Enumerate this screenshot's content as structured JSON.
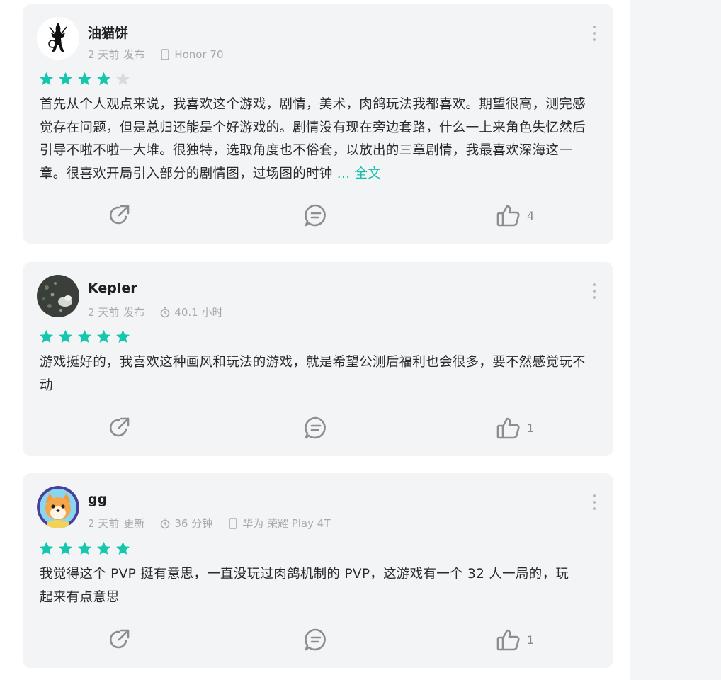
{
  "colors": {
    "accent": "#14bfa8",
    "star_filled": "#16c6ad",
    "star_empty": "#d9dcdf",
    "card_bg": "#f3f4f6",
    "icon_gray": "#8d8d8d"
  },
  "reviews": [
    {
      "username": "油猫饼",
      "time": "2 天前",
      "action": "发布",
      "device": "Honor 70",
      "rating": 4,
      "text": "首先从个人观点来说，我喜欢这个游戏，剧情，美术，肉鸽玩法我都喜欢。期望很高，测完感觉存在问题，但是总归还能是个好游戏的。剧情没有现在旁边套路，什么一上来角色失忆然后引导不啦不啦一大堆。很独特，选取角度也不俗套，以放出的三章剧情，我最喜欢深海这一章。很喜欢开局引入部分的剧情图，过场图的时钟",
      "more_link": "... 全文",
      "like_count": "4"
    },
    {
      "username": "Kepler",
      "time": "2 天前",
      "action": "发布",
      "playtime": "40.1 小时",
      "rating": 5,
      "text": "游戏挺好的，我喜欢这种画风和玩法的游戏，就是希望公测后福利也会很多，要不然感觉玩不动",
      "like_count": "1"
    },
    {
      "username": "gg",
      "time": "2 天前",
      "action": "更新",
      "playtime": "36 分钟",
      "device": "华为 荣耀 Play 4T",
      "rating": 5,
      "text": "我觉得这个 PVP 挺有意思，一直没玩过肉鸽机制的 PVP，这游戏有一个 32 人一局的，玩起来有点意思",
      "like_count": "1"
    }
  ]
}
